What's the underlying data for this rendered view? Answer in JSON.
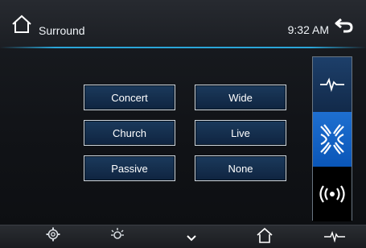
{
  "header": {
    "title": "Surround",
    "time": "9:32 AM"
  },
  "modes": {
    "concert": "Concert",
    "wide": "Wide",
    "church": "Church",
    "live": "Live",
    "passive": "Passive",
    "none": "None"
  },
  "side_tabs": {
    "icons": [
      "equalizer-icon",
      "surround-icon",
      "speaker-signal-icon"
    ],
    "active": "surround"
  },
  "bottom_nav": {
    "icons": [
      "settings-icon",
      "brightness-icon",
      "chevron-down-icon",
      "home-icon",
      "equalizer-icon"
    ]
  },
  "colors": {
    "accent_line": "#2aa6d8",
    "button_fill": "#1b3a5c",
    "active_tab": "#1e6fd0"
  }
}
